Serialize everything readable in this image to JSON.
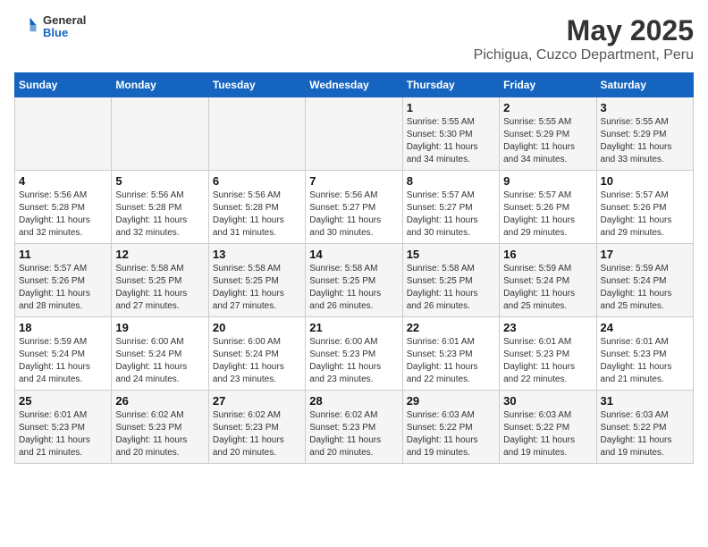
{
  "header": {
    "logo_general": "General",
    "logo_blue": "Blue",
    "main_title": "May 2025",
    "subtitle": "Pichigua, Cuzco Department, Peru"
  },
  "weekdays": [
    "Sunday",
    "Monday",
    "Tuesday",
    "Wednesday",
    "Thursday",
    "Friday",
    "Saturday"
  ],
  "weeks": [
    [
      {
        "day": "",
        "info": ""
      },
      {
        "day": "",
        "info": ""
      },
      {
        "day": "",
        "info": ""
      },
      {
        "day": "",
        "info": ""
      },
      {
        "day": "1",
        "info": "Sunrise: 5:55 AM\nSunset: 5:30 PM\nDaylight: 11 hours\nand 34 minutes."
      },
      {
        "day": "2",
        "info": "Sunrise: 5:55 AM\nSunset: 5:29 PM\nDaylight: 11 hours\nand 34 minutes."
      },
      {
        "day": "3",
        "info": "Sunrise: 5:55 AM\nSunset: 5:29 PM\nDaylight: 11 hours\nand 33 minutes."
      }
    ],
    [
      {
        "day": "4",
        "info": "Sunrise: 5:56 AM\nSunset: 5:28 PM\nDaylight: 11 hours\nand 32 minutes."
      },
      {
        "day": "5",
        "info": "Sunrise: 5:56 AM\nSunset: 5:28 PM\nDaylight: 11 hours\nand 32 minutes."
      },
      {
        "day": "6",
        "info": "Sunrise: 5:56 AM\nSunset: 5:28 PM\nDaylight: 11 hours\nand 31 minutes."
      },
      {
        "day": "7",
        "info": "Sunrise: 5:56 AM\nSunset: 5:27 PM\nDaylight: 11 hours\nand 30 minutes."
      },
      {
        "day": "8",
        "info": "Sunrise: 5:57 AM\nSunset: 5:27 PM\nDaylight: 11 hours\nand 30 minutes."
      },
      {
        "day": "9",
        "info": "Sunrise: 5:57 AM\nSunset: 5:26 PM\nDaylight: 11 hours\nand 29 minutes."
      },
      {
        "day": "10",
        "info": "Sunrise: 5:57 AM\nSunset: 5:26 PM\nDaylight: 11 hours\nand 29 minutes."
      }
    ],
    [
      {
        "day": "11",
        "info": "Sunrise: 5:57 AM\nSunset: 5:26 PM\nDaylight: 11 hours\nand 28 minutes."
      },
      {
        "day": "12",
        "info": "Sunrise: 5:58 AM\nSunset: 5:25 PM\nDaylight: 11 hours\nand 27 minutes."
      },
      {
        "day": "13",
        "info": "Sunrise: 5:58 AM\nSunset: 5:25 PM\nDaylight: 11 hours\nand 27 minutes."
      },
      {
        "day": "14",
        "info": "Sunrise: 5:58 AM\nSunset: 5:25 PM\nDaylight: 11 hours\nand 26 minutes."
      },
      {
        "day": "15",
        "info": "Sunrise: 5:58 AM\nSunset: 5:25 PM\nDaylight: 11 hours\nand 26 minutes."
      },
      {
        "day": "16",
        "info": "Sunrise: 5:59 AM\nSunset: 5:24 PM\nDaylight: 11 hours\nand 25 minutes."
      },
      {
        "day": "17",
        "info": "Sunrise: 5:59 AM\nSunset: 5:24 PM\nDaylight: 11 hours\nand 25 minutes."
      }
    ],
    [
      {
        "day": "18",
        "info": "Sunrise: 5:59 AM\nSunset: 5:24 PM\nDaylight: 11 hours\nand 24 minutes."
      },
      {
        "day": "19",
        "info": "Sunrise: 6:00 AM\nSunset: 5:24 PM\nDaylight: 11 hours\nand 24 minutes."
      },
      {
        "day": "20",
        "info": "Sunrise: 6:00 AM\nSunset: 5:24 PM\nDaylight: 11 hours\nand 23 minutes."
      },
      {
        "day": "21",
        "info": "Sunrise: 6:00 AM\nSunset: 5:23 PM\nDaylight: 11 hours\nand 23 minutes."
      },
      {
        "day": "22",
        "info": "Sunrise: 6:01 AM\nSunset: 5:23 PM\nDaylight: 11 hours\nand 22 minutes."
      },
      {
        "day": "23",
        "info": "Sunrise: 6:01 AM\nSunset: 5:23 PM\nDaylight: 11 hours\nand 22 minutes."
      },
      {
        "day": "24",
        "info": "Sunrise: 6:01 AM\nSunset: 5:23 PM\nDaylight: 11 hours\nand 21 minutes."
      }
    ],
    [
      {
        "day": "25",
        "info": "Sunrise: 6:01 AM\nSunset: 5:23 PM\nDaylight: 11 hours\nand 21 minutes."
      },
      {
        "day": "26",
        "info": "Sunrise: 6:02 AM\nSunset: 5:23 PM\nDaylight: 11 hours\nand 20 minutes."
      },
      {
        "day": "27",
        "info": "Sunrise: 6:02 AM\nSunset: 5:23 PM\nDaylight: 11 hours\nand 20 minutes."
      },
      {
        "day": "28",
        "info": "Sunrise: 6:02 AM\nSunset: 5:23 PM\nDaylight: 11 hours\nand 20 minutes."
      },
      {
        "day": "29",
        "info": "Sunrise: 6:03 AM\nSunset: 5:22 PM\nDaylight: 11 hours\nand 19 minutes."
      },
      {
        "day": "30",
        "info": "Sunrise: 6:03 AM\nSunset: 5:22 PM\nDaylight: 11 hours\nand 19 minutes."
      },
      {
        "day": "31",
        "info": "Sunrise: 6:03 AM\nSunset: 5:22 PM\nDaylight: 11 hours\nand 19 minutes."
      }
    ]
  ]
}
